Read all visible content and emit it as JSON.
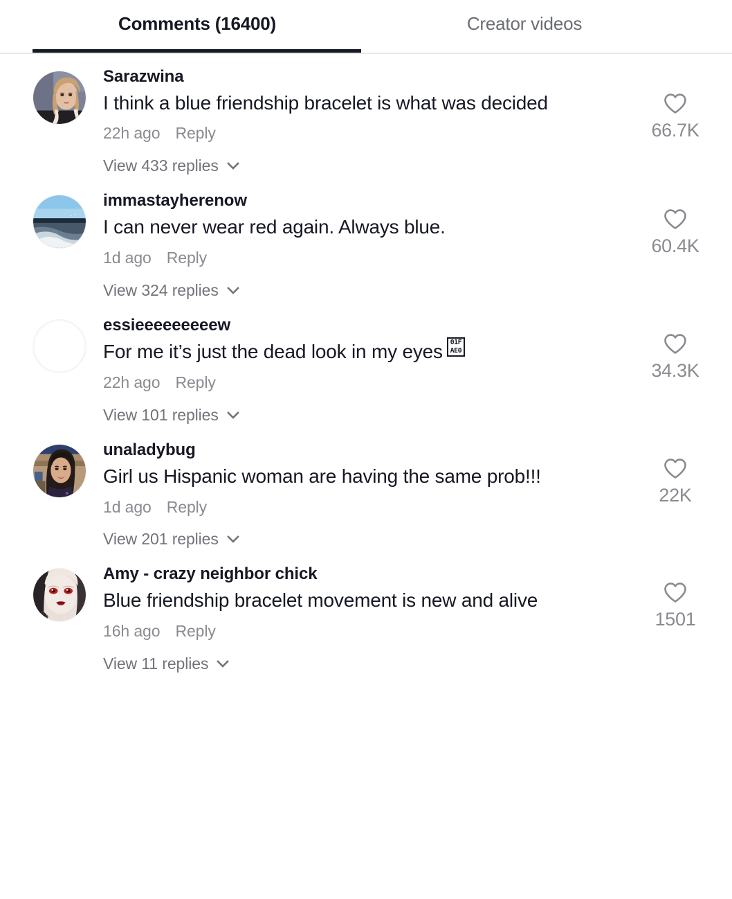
{
  "tabs": [
    {
      "label": "Comments (16400)",
      "active": true,
      "name": "tab-comments"
    },
    {
      "label": "Creator videos",
      "active": false,
      "name": "tab-creator-videos"
    }
  ],
  "colors": {
    "text_primary": "#161823",
    "text_secondary": "#8a8b91",
    "text_replies": "#72747b",
    "underline": "#161823",
    "divider": "#e8e8e9",
    "background": "#ffffff"
  },
  "icons": {
    "heart": "heart-outline-icon",
    "chevron": "chevron-down-icon"
  },
  "comments": [
    {
      "username": "Sarazwina",
      "text": "I think a blue friendship bracelet is what was decided",
      "time": "22h ago",
      "reply_label": "Reply",
      "view_replies": "View 433 replies",
      "likes": "66.7K",
      "avatar": "blonde-woman-photo",
      "has_avatar": true,
      "emoji_box": false
    },
    {
      "username": "immastayherenow",
      "text": "I can never wear red again. Always blue.",
      "time": "1d ago",
      "reply_label": "Reply",
      "view_replies": "View 324 replies",
      "likes": "60.4K",
      "avatar": "ocean-boat-wake-photo",
      "has_avatar": true,
      "emoji_box": false
    },
    {
      "username": "essieeeeeeeeew",
      "text": "For me it’s just the dead look in my eyes",
      "time": "22h ago",
      "reply_label": "Reply",
      "view_replies": "View 101 replies",
      "likes": "34.3K",
      "avatar": "blank-avatar",
      "has_avatar": false,
      "emoji_box": true,
      "emoji_box_rows": [
        "01F",
        "AE0"
      ]
    },
    {
      "username": "unaladybug",
      "text": "Girl us Hispanic woman are having the same prob!!!",
      "time": "1d ago",
      "reply_label": "Reply",
      "view_replies": "View 201 replies",
      "likes": "22K",
      "avatar": "dark-haired-woman-photo",
      "has_avatar": true,
      "emoji_box": false
    },
    {
      "username": "Amy - crazy neighbor chick",
      "text": "Blue friendship bracelet movement is new and alive",
      "time": "16h ago",
      "reply_label": "Reply",
      "view_replies": "View 11 replies",
      "likes": "1501",
      "avatar": "pale-red-eyes-doll-photo",
      "has_avatar": true,
      "emoji_box": false
    }
  ]
}
